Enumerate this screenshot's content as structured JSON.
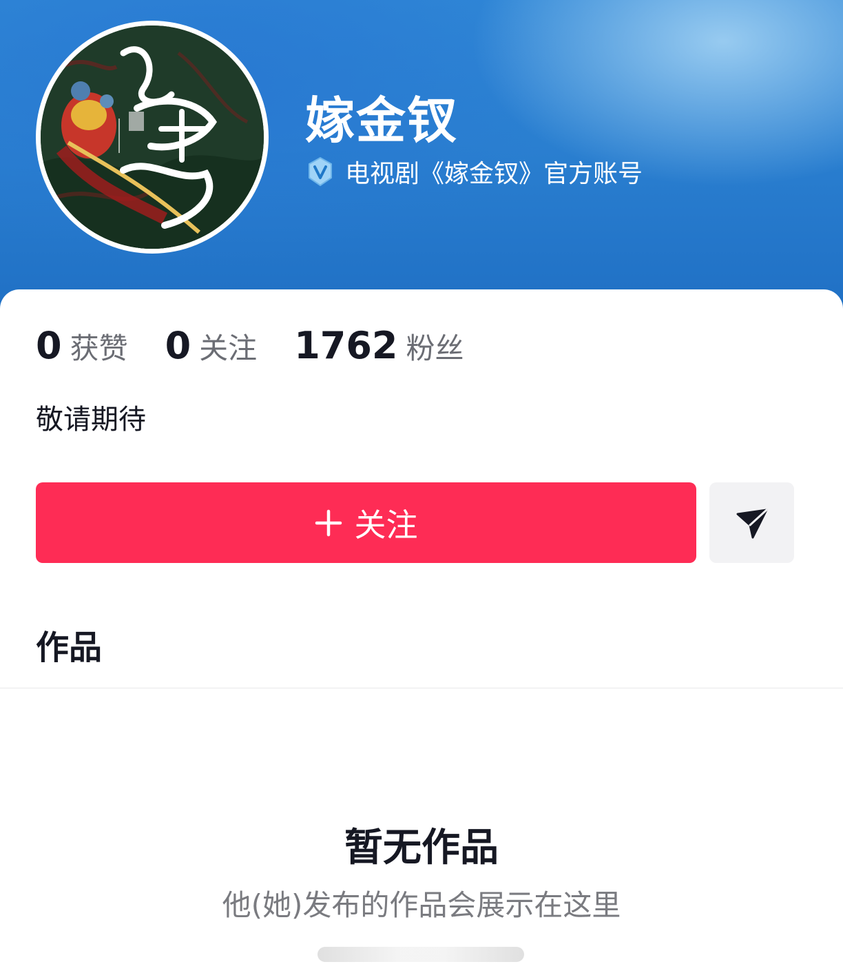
{
  "profile": {
    "name": "嫁金钗",
    "verification": "电视剧《嫁金钗》官方账号",
    "bio": "敬请期待"
  },
  "stats": [
    {
      "value": "0",
      "label": "获赞"
    },
    {
      "value": "0",
      "label": "关注"
    },
    {
      "value": "1762",
      "label": "粉丝"
    }
  ],
  "actions": {
    "follow_label": "关注",
    "share_icon": "send-icon"
  },
  "tabs": {
    "works_label": "作品"
  },
  "empty_state": {
    "title": "暂无作品",
    "subtitle": "他(她)发布的作品会展示在这里"
  },
  "colors": {
    "accent": "#fe2c55",
    "header_blue": "#2a7fd0"
  }
}
